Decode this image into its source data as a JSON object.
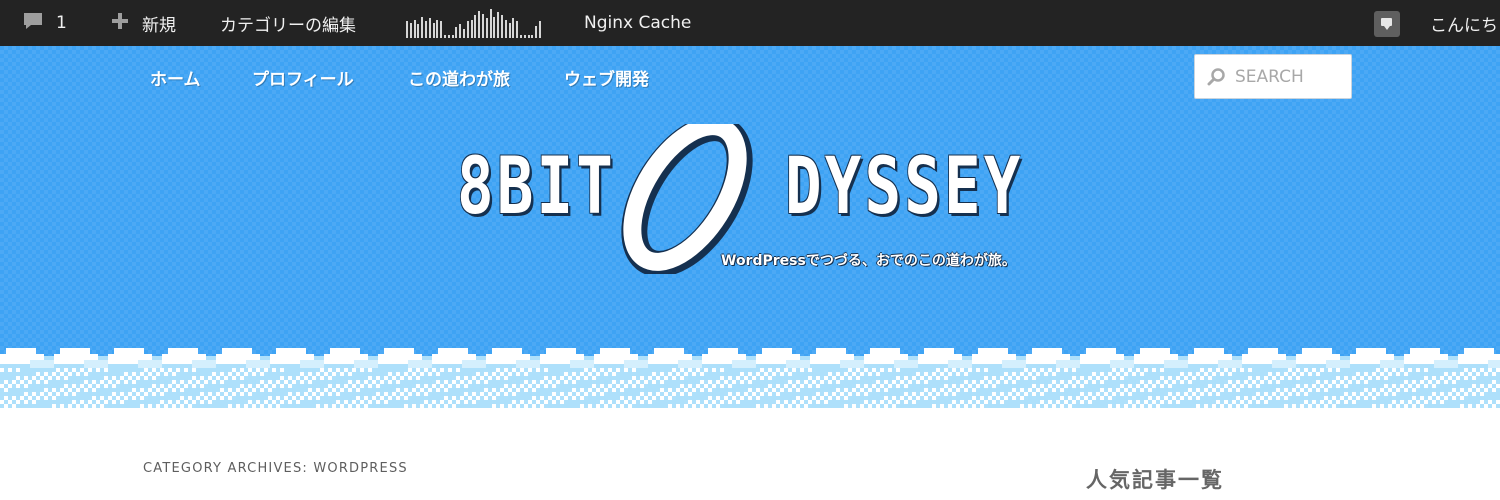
{
  "admin_bar": {
    "comments_count": "1",
    "new_label": "新規",
    "edit_category_label": "カテゴリーの編集",
    "cache_label": "Nginx Cache",
    "greeting": "こんにち",
    "stats_bars": [
      0.55,
      0.5,
      0.6,
      0.45,
      0.7,
      0.55,
      0.65,
      0.5,
      0.6,
      0.55,
      0.1,
      0.1,
      0.1,
      0.35,
      0.45,
      0.3,
      0.55,
      0.6,
      0.75,
      0.9,
      0.8,
      0.65,
      0.95,
      0.7,
      0.85,
      0.75,
      0.6,
      0.5,
      0.65,
      0.55,
      0.1,
      0.1,
      0.1,
      0.1,
      0.4,
      0.55
    ]
  },
  "nav": {
    "items": [
      "ホーム",
      "プロフィール",
      "この道わが旅",
      "ウェブ開発"
    ]
  },
  "search": {
    "placeholder": "SEARCH"
  },
  "site": {
    "logo_left": "8BIT",
    "logo_right": "DYSSEY",
    "tagline": "WordPressでつづる、おでのこの道わが旅。"
  },
  "content": {
    "archive_title": "CATEGORY ARCHIVES: WORDPRESS"
  },
  "sidebar": {
    "widget_title": "人気記事一覧"
  },
  "colors": {
    "admin_bar_bg": "#232323",
    "header_sky": "#3ea3f4",
    "logo_shadow": "#15304f",
    "cloud_light": "#aee0fb"
  }
}
